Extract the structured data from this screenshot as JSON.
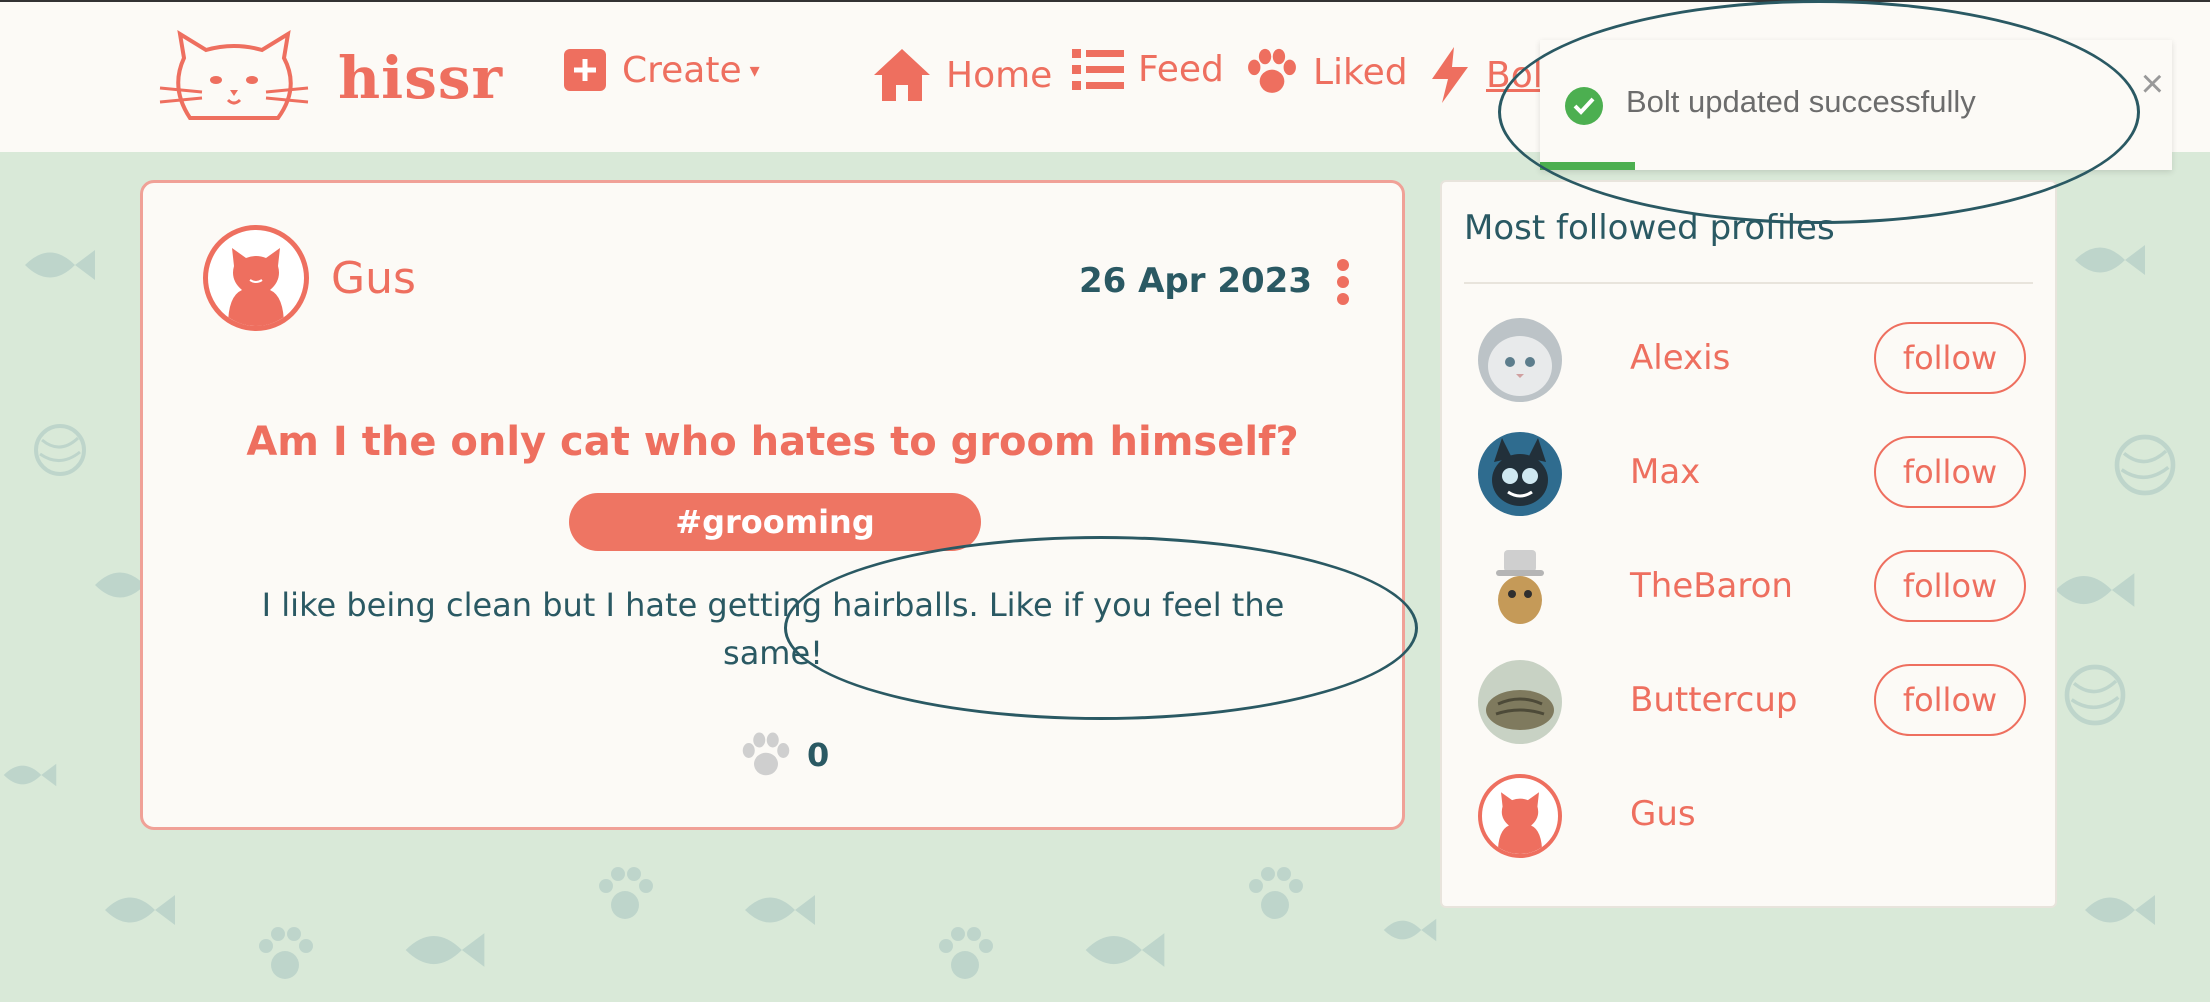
{
  "brand": {
    "name": "hissr"
  },
  "nav": {
    "create_label": "Create",
    "home_label": "Home",
    "feed_label": "Feed",
    "liked_label": "Liked",
    "bolt_label": "Bolt"
  },
  "post": {
    "author": "Gus",
    "date": "26 Apr 2023",
    "title": "Am I the only cat who hates to groom himself?",
    "hashtag": "#grooming",
    "body": "I like being clean but I hate getting hairballs. Like if you feel the same!",
    "likes": "0"
  },
  "sidebar": {
    "title": "Most followed profiles",
    "follow_label": "follow",
    "profiles": [
      {
        "name": "Alexis",
        "avatar": "persian-cat-photo"
      },
      {
        "name": "Max",
        "avatar": "cartoon-cat-photo"
      },
      {
        "name": "TheBaron",
        "avatar": "baron-cat-figurine-photo"
      },
      {
        "name": "Buttercup",
        "avatar": "tabby-cat-photo"
      },
      {
        "name": "Gus",
        "avatar": "default-cat-avatar"
      }
    ]
  },
  "toast": {
    "message": "Bolt updated successfully",
    "close_symbol": "×",
    "progress": 0.15
  },
  "colors": {
    "brand": "#ee6f5f",
    "text_dark": "#2a5963",
    "background": "#d9e9d8",
    "success": "#4caf50"
  }
}
